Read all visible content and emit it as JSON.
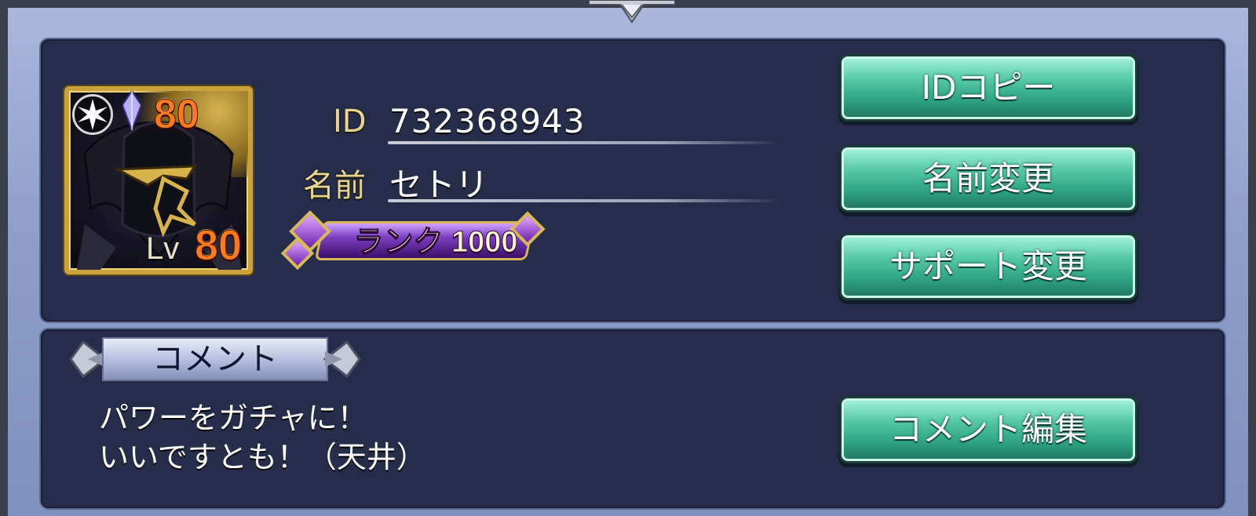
{
  "avatar": {
    "rarity": "80",
    "level_label": "Lv",
    "level": "80"
  },
  "profile": {
    "id_label": "ID",
    "id_value": "732368943",
    "name_label": "名前",
    "name_value": "セトリ",
    "rank_text": "ランク 1000"
  },
  "buttons": {
    "id_copy": "IDコピー",
    "name_change": "名前変更",
    "support_change": "サポート変更",
    "comment_edit": "コメント編集"
  },
  "comment": {
    "header": "コメント",
    "line1": "パワーをガチャに！",
    "line2": "いいですとも！（天井）"
  },
  "colors": {
    "accent_button": "#2fa584",
    "panel_bg": "#262d4a",
    "frame_bg": "#8d9ec9",
    "rank_purple": "#7c3ec0"
  }
}
